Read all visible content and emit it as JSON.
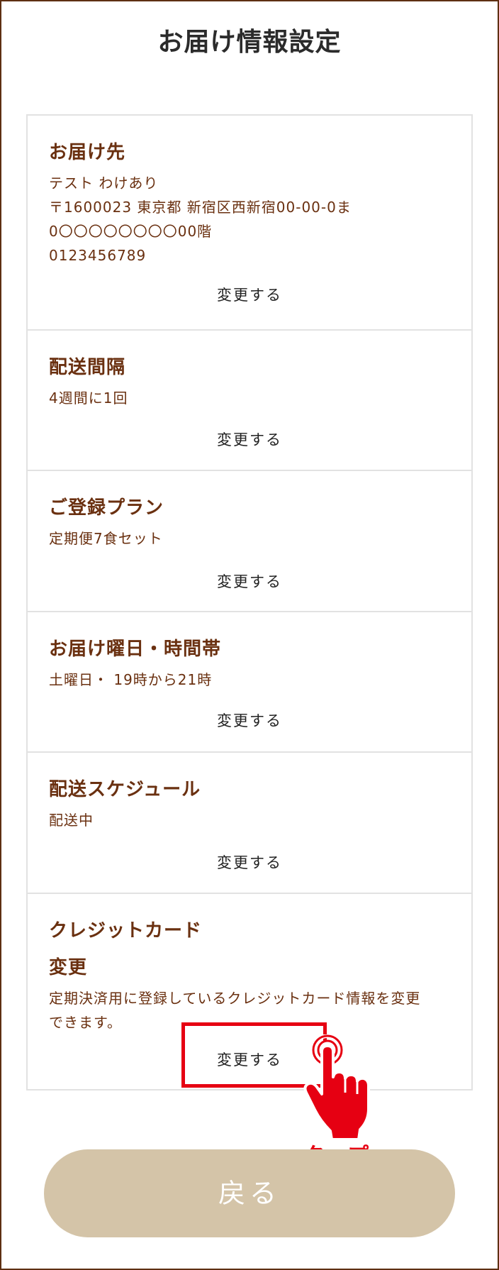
{
  "header": {
    "title": "お届け情報設定"
  },
  "sections": [
    {
      "heading": "お届け先",
      "lines": [
        "テスト わけあり",
        "〒1600023 東京都 新宿区西新宿00-00-0ま",
        "0〇〇〇〇〇〇〇〇00階",
        "0123456789"
      ],
      "change_label": "変更する"
    },
    {
      "heading": "配送間隔",
      "lines": [
        "4週間に1回"
      ],
      "change_label": "変更する"
    },
    {
      "heading": "ご登録プラン",
      "lines": [
        "定期便7食セット"
      ],
      "change_label": "変更する"
    },
    {
      "heading": "お届け曜日・時間帯",
      "lines": [
        "土曜日・ 19時から21時"
      ],
      "change_label": "変更する"
    },
    {
      "heading": "配送スケジュール",
      "lines": [
        "配送中"
      ],
      "change_label": "変更する"
    },
    {
      "heading_lines": [
        "クレジットカード",
        "変更"
      ],
      "lines": [
        "定期決済用に登録しているクレジットカード情報を変更",
        "できます。"
      ],
      "change_label": "変更する"
    }
  ],
  "annotation": {
    "tap_label": "タップ",
    "color": "#e60012"
  },
  "footer": {
    "back_label": "戻る"
  },
  "colors": {
    "accent": "#6a3010",
    "frame": "#5e2f12",
    "back_button": "#d4c4a8"
  }
}
